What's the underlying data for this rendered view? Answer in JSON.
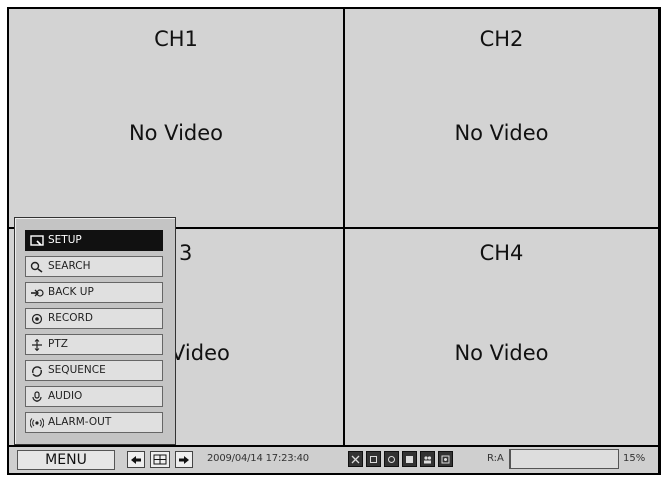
{
  "channels": [
    {
      "title": "CH1",
      "status": "No Video"
    },
    {
      "title": "CH2",
      "status": "No Video"
    },
    {
      "title": "3",
      "status": "Video"
    },
    {
      "title": "CH4",
      "status": "No Video"
    }
  ],
  "menu": {
    "items": [
      {
        "label": "SETUP",
        "icon": "setup-icon",
        "active": true
      },
      {
        "label": "SEARCH",
        "icon": "search-icon",
        "active": false
      },
      {
        "label": "BACK UP",
        "icon": "backup-icon",
        "active": false
      },
      {
        "label": "RECORD",
        "icon": "record-icon",
        "active": false
      },
      {
        "label": "PTZ",
        "icon": "ptz-icon",
        "active": false
      },
      {
        "label": "SEQUENCE",
        "icon": "sequence-icon",
        "active": false
      },
      {
        "label": "AUDIO",
        "icon": "audio-icon",
        "active": false
      },
      {
        "label": "ALARM-OUT",
        "icon": "alarm-out-icon",
        "active": false
      }
    ]
  },
  "statusbar": {
    "menu_label": "MENU",
    "datetime": "2009/04/14 17:23:40",
    "ra_label": "R:A",
    "disk_usage_percent": 15,
    "disk_usage_label": "15%"
  },
  "colors": {
    "cell_bg": "#d3d3d3",
    "grid_line": "#000000",
    "active_item": "#111111"
  }
}
